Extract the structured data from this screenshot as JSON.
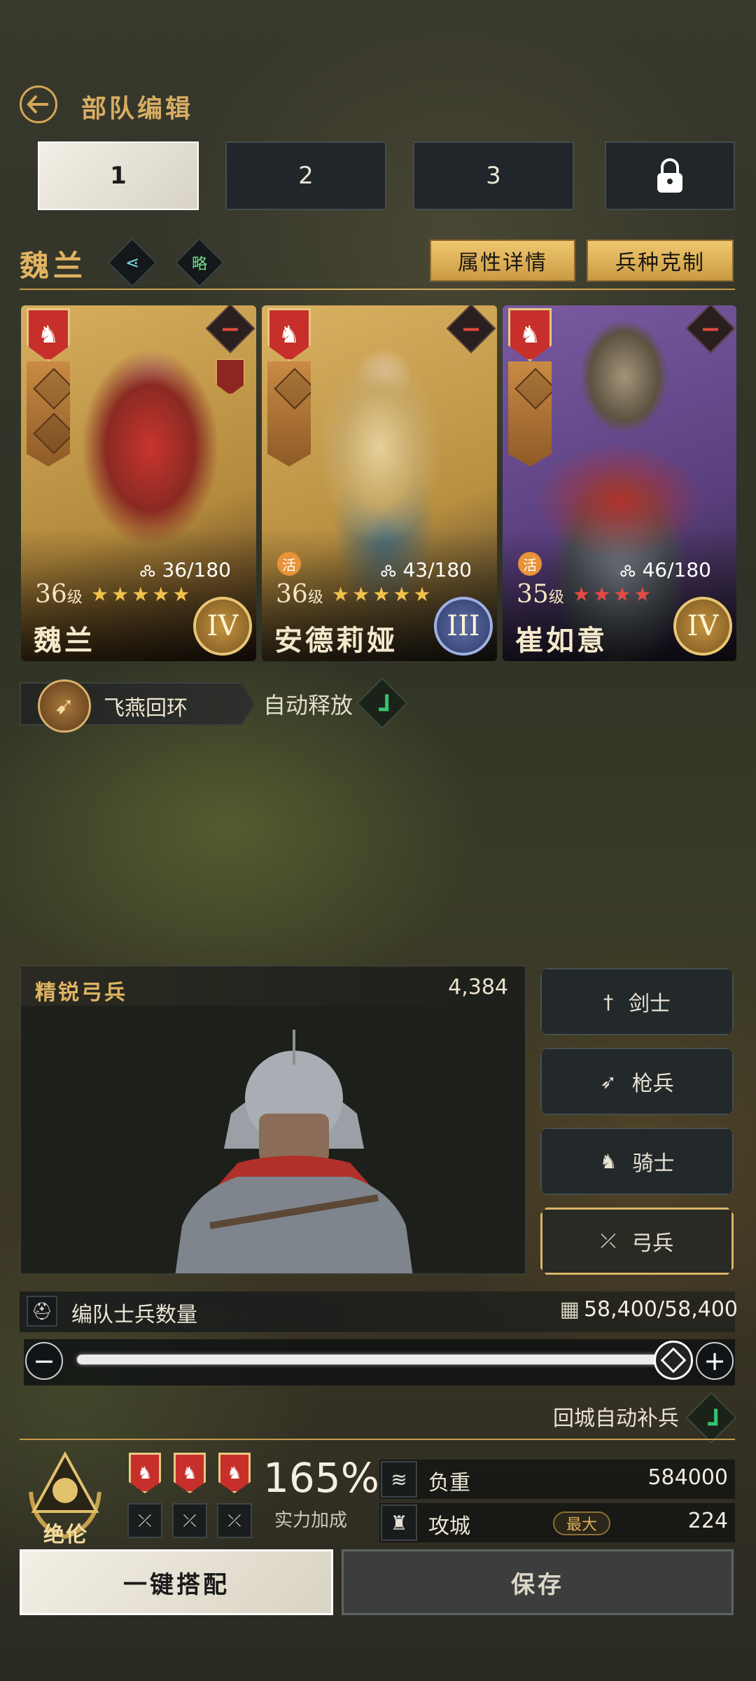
{
  "header": {
    "title": "部队编辑"
  },
  "tabs": [
    {
      "label": "1",
      "active": true
    },
    {
      "label": "2",
      "active": false
    },
    {
      "label": "3",
      "active": false
    },
    {
      "label": "",
      "locked": true,
      "icon": "lock-icon"
    }
  ],
  "commander": {
    "name": "魏兰",
    "strategy_badge": "略",
    "attr_details_label": "属性详情",
    "counter_label": "兵种克制"
  },
  "heroes": [
    {
      "name": "魏兰",
      "level": "36",
      "level_unit": "级",
      "exp": "36/180",
      "stars": "★★★★★",
      "star_color": "#f1c24b",
      "rank": "IV",
      "rank_style": "gold",
      "badge": "",
      "portrait_bg": "#c49a4a"
    },
    {
      "name": "安德莉娅",
      "level": "36",
      "level_unit": "级",
      "exp": "43/180",
      "stars": "★★★★★",
      "star_color": "#f1c24b",
      "rank": "III",
      "rank_style": "blue",
      "badge": "活",
      "portrait_bg": "#c79b4b"
    },
    {
      "name": "崔如意",
      "level": "35",
      "level_unit": "级",
      "exp": "46/180",
      "stars": "★★★★",
      "star_color": "#e34b42",
      "stars_tail": "★★",
      "tail_color": "#f1c24b",
      "rank": "IV",
      "rank_style": "gold",
      "badge": "活",
      "portrait_bg": "#6a4c8f"
    }
  ],
  "skill": {
    "name": "飞燕回环",
    "auto_label": "自动释放",
    "auto_enabled": true
  },
  "troop": {
    "name": "精锐弓兵",
    "count": "4,384"
  },
  "troop_types": [
    {
      "label": "剑士",
      "icon": "sword-icon",
      "glyph": "†",
      "active": false
    },
    {
      "label": "枪兵",
      "icon": "spear-icon",
      "glyph": "➶",
      "active": false
    },
    {
      "label": "骑士",
      "icon": "horse-icon",
      "glyph": "♞",
      "active": false
    },
    {
      "label": "弓兵",
      "icon": "bow-icon",
      "glyph": "⤫",
      "active": true
    }
  ],
  "soldiers": {
    "label": "编队士兵数量",
    "value": "58,400/58,400",
    "fill": 1.0
  },
  "auto_refill": {
    "label": "回城自动补兵",
    "enabled": true
  },
  "summary": {
    "rank_label": "绝伦",
    "power": "165%",
    "power_label": "实力加成",
    "load_label": "负重",
    "load_value": "584000",
    "siege_label": "攻城",
    "siege_badge": "最大",
    "siege_value": "224"
  },
  "actions": {
    "auto_match": "一键搭配",
    "save": "保存"
  },
  "colors": {
    "accent_gold": "#d9ad62",
    "check_green": "#37c36f",
    "shield_red": "#c7302a"
  }
}
